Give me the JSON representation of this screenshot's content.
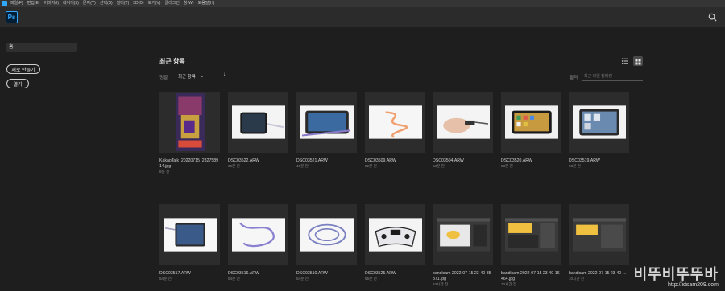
{
  "menubar": {
    "items": [
      "파일(F)",
      "편집(E)",
      "이미지(I)",
      "레이어(L)",
      "문자(Y)",
      "선택(S)",
      "필터(T)",
      "3D(D)",
      "보기(V)",
      "플러그인",
      "창(W)",
      "도움말(H)"
    ]
  },
  "app": {
    "logo_text": "Ps"
  },
  "sidebar": {
    "home_label": "홈",
    "new_button": "새로 만들기",
    "open_button": "열기"
  },
  "main": {
    "title": "최근 항목",
    "sort_label": "정렬",
    "sort_value": "최근 항목",
    "sort_direction": "↓",
    "filter_label": "필터",
    "filter_placeholder": "최근 파일 필터링"
  },
  "files": [
    {
      "name": "KakaoTalk_20220715_232758914.jpg",
      "time": "8분 전",
      "thumb": "poster"
    },
    {
      "name": "DSC03522.ARW",
      "time": "36분 전",
      "thumb": "phone-cable"
    },
    {
      "name": "DSC03521.ARW",
      "time": "40분 전",
      "thumb": "tablet-cable"
    },
    {
      "name": "DSC03509.ARW",
      "time": "52분 전",
      "thumb": "orange-cable"
    },
    {
      "name": "DSC03504.ARW",
      "time": "53분 전",
      "thumb": "hand-cable"
    },
    {
      "name": "DSC03520.ARW",
      "time": "53분 전",
      "thumb": "phone-apps"
    },
    {
      "name": "DSC03519.ARW",
      "time": "53분 전",
      "thumb": "tablet-apps"
    },
    {
      "name": "DSC03517.ARW",
      "time": "54분 전",
      "thumb": "tablet-white"
    },
    {
      "name": "DSC03516.ARW",
      "time": "54분 전",
      "thumb": "purple-cable"
    },
    {
      "name": "DSC03510.ARW",
      "time": "54분 전",
      "thumb": "cable-coil"
    },
    {
      "name": "DSC03525.ARW",
      "time": "55분 전",
      "thumb": "controller"
    },
    {
      "name": "bandicam 2022-07-15 23-40-35-871.jpg",
      "time": "10시간 전",
      "thumb": "screen-1"
    },
    {
      "name": "bandicam 2022-07-15 23-40-16-464.jpg",
      "time": "10시간 전",
      "thumb": "screen-2"
    },
    {
      "name": "bandicam 2022-07-15 23-40-...",
      "time": "10시간 전",
      "thumb": "screen-3"
    }
  ],
  "watermark": {
    "big": "비뚜비뚜뚜바",
    "small": "http://idsam209.com"
  },
  "colors": {
    "accent": "#31a8ff",
    "background": "#1e1e1e",
    "card": "#2c2c2c"
  }
}
